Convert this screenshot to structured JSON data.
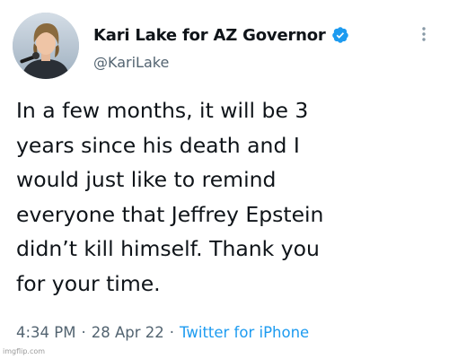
{
  "profile": {
    "display_name": "Kari Lake for AZ Governor",
    "handle": "@KariLake",
    "verified": true
  },
  "tweet": {
    "lines": [
      "In a few months, it will be 3",
      "years since his death and I",
      "would just like to remind",
      "everyone that Jeffrey Epstein",
      "didn’t kill himself. Thank you",
      "for your time."
    ],
    "time": "4:34 PM",
    "separator": "·",
    "date": "28 Apr 22",
    "source": "Twitter for iPhone"
  },
  "watermark": "imgflip.com",
  "colors": {
    "text": "#0f1419",
    "secondary": "#536471",
    "link": "#1d9bf0",
    "verified_badge": "#1d9bf0"
  },
  "icons": {
    "verified": "verified-badge-icon",
    "more": "more-options-icon"
  }
}
